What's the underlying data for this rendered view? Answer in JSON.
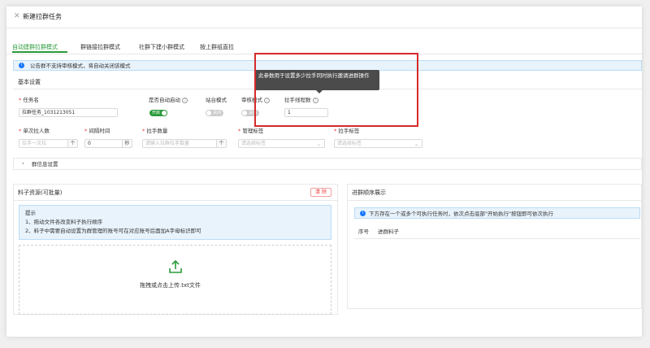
{
  "window": {
    "title": "新建拉群任务",
    "close_icon": "close-icon"
  },
  "tabs": [
    {
      "label": "自动建群拉群模式",
      "active": true
    },
    {
      "label": "群链接拉群模式",
      "active": false
    },
    {
      "label": "社群下建小群模式",
      "active": false
    },
    {
      "label": "按上群组直拉",
      "active": false
    }
  ],
  "notice": {
    "text": "公告群不支持审核模式，将自动关闭该模式"
  },
  "basic_settings": {
    "heading": "基本设置",
    "task_name": {
      "label": "任务名",
      "value": "拉群任务_1031213051"
    },
    "auto_start": {
      "label": "是否自动启动",
      "state": "开启"
    },
    "station_mode": {
      "label": "站台模式",
      "state": "关闭"
    },
    "review_mode": {
      "label": "审核模式",
      "state": "关闭"
    },
    "puller_threads": {
      "label": "拉手线程数",
      "value": "1"
    },
    "per_invite": {
      "label": "单次拉人数",
      "placeholder": "拉手一次拉",
      "addon": "个"
    },
    "interval": {
      "label": "间隔时间",
      "value": "0",
      "addon": "秒"
    },
    "puller_count": {
      "label": "拉手数量",
      "placeholder": "请输入拉群拉手数量",
      "addon": "个"
    },
    "admin_tag": {
      "label": "管理标签",
      "placeholder": "请选择标签"
    },
    "puller_tag": {
      "label": "拉手标签",
      "placeholder": "请选择标签"
    },
    "group_info": {
      "label": "群信息设置"
    }
  },
  "material": {
    "heading": "料子资源(可批量)",
    "clear_label": "清 除",
    "tip_title": "提示",
    "tip_line1": "1、拖动文件各改变料子执行顺序",
    "tip_line2": "2、料子中需要自动设置为群管理的账号可在对应账号后面加A字母标识即可",
    "upload_text": "拖拽或点击上传.txt文件",
    "upload_icon": "upload-icon"
  },
  "order": {
    "heading": "进群顺序展示",
    "notice": "下方存在一个或多个可执行任务时，依次点击底部\"开始执行\"按钮即可依次执行",
    "col_index": "序号",
    "col_material": "进群料子"
  },
  "tooltip": {
    "text": "此参数用于设置多少拉手同时执行邀请进群操作"
  },
  "colors": {
    "accent": "#2a9a3a",
    "danger": "#e33333",
    "info": "#1677ff",
    "highlight": "#d62a2a"
  }
}
